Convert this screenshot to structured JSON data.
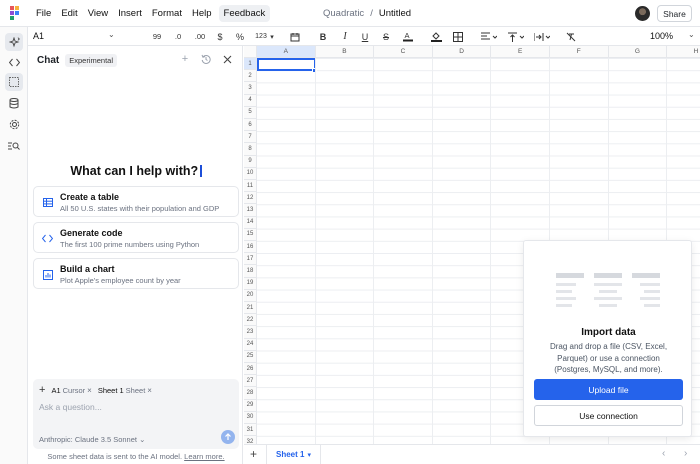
{
  "menubar": {
    "items": [
      "File",
      "Edit",
      "View",
      "Insert",
      "Format",
      "Help"
    ],
    "feedback_label": "Feedback",
    "app_name": "Quadratic",
    "separator": "/",
    "doc_name": "Untitled",
    "share_label": "Share"
  },
  "toolbar": {
    "cell_ref": "A1",
    "decimal_99": "99",
    "dec_decrease": ".0",
    "dec_increase": ".00",
    "currency": "$",
    "percent": "%",
    "number_format": "123",
    "zoom": "100%"
  },
  "chat": {
    "title": "Chat",
    "badge": "Experimental",
    "hero": "What can I help with?",
    "suggestions": [
      {
        "title": "Create a table",
        "subtitle": "All 50 U.S. states with their population and GDP",
        "icon": "table-icon"
      },
      {
        "title": "Generate code",
        "subtitle": "The first 100 prime numbers using Python",
        "icon": "code-icon"
      },
      {
        "title": "Build a chart",
        "subtitle": "Plot Apple's employee count by year",
        "icon": "chart-icon"
      }
    ],
    "context": [
      {
        "name": "A1",
        "kind": "Cursor"
      },
      {
        "name": "Sheet 1",
        "kind": "Sheet"
      }
    ],
    "placeholder": "Ask a question...",
    "model": "Anthropic: Claude 3.5 Sonnet",
    "disclaimer_text": "Some sheet data is sent to the AI model.",
    "disclaimer_link": "Learn more."
  },
  "grid": {
    "columns": [
      "A",
      "B",
      "C",
      "D",
      "E",
      "F",
      "G",
      "H"
    ],
    "rows": [
      "1",
      "2",
      "3",
      "4",
      "5",
      "6",
      "7",
      "8",
      "9",
      "10",
      "11",
      "12",
      "13",
      "14",
      "15",
      "16",
      "17",
      "18",
      "19",
      "20",
      "21",
      "22",
      "23",
      "24",
      "25",
      "26",
      "27",
      "28",
      "29",
      "30",
      "31",
      "32"
    ]
  },
  "import_panel": {
    "title": "Import data",
    "description": "Drag and drop a file (CSV, Excel, Parquet) or use a connection (Postgres, MySQL, and more).",
    "upload_label": "Upload file",
    "connection_label": "Use connection"
  },
  "sheets": {
    "tabs": [
      "Sheet 1"
    ],
    "add_label": "+"
  },
  "colors": {
    "accent": "#2563eb",
    "selection": "#dbe7fb",
    "border": "#e5e7eb"
  }
}
